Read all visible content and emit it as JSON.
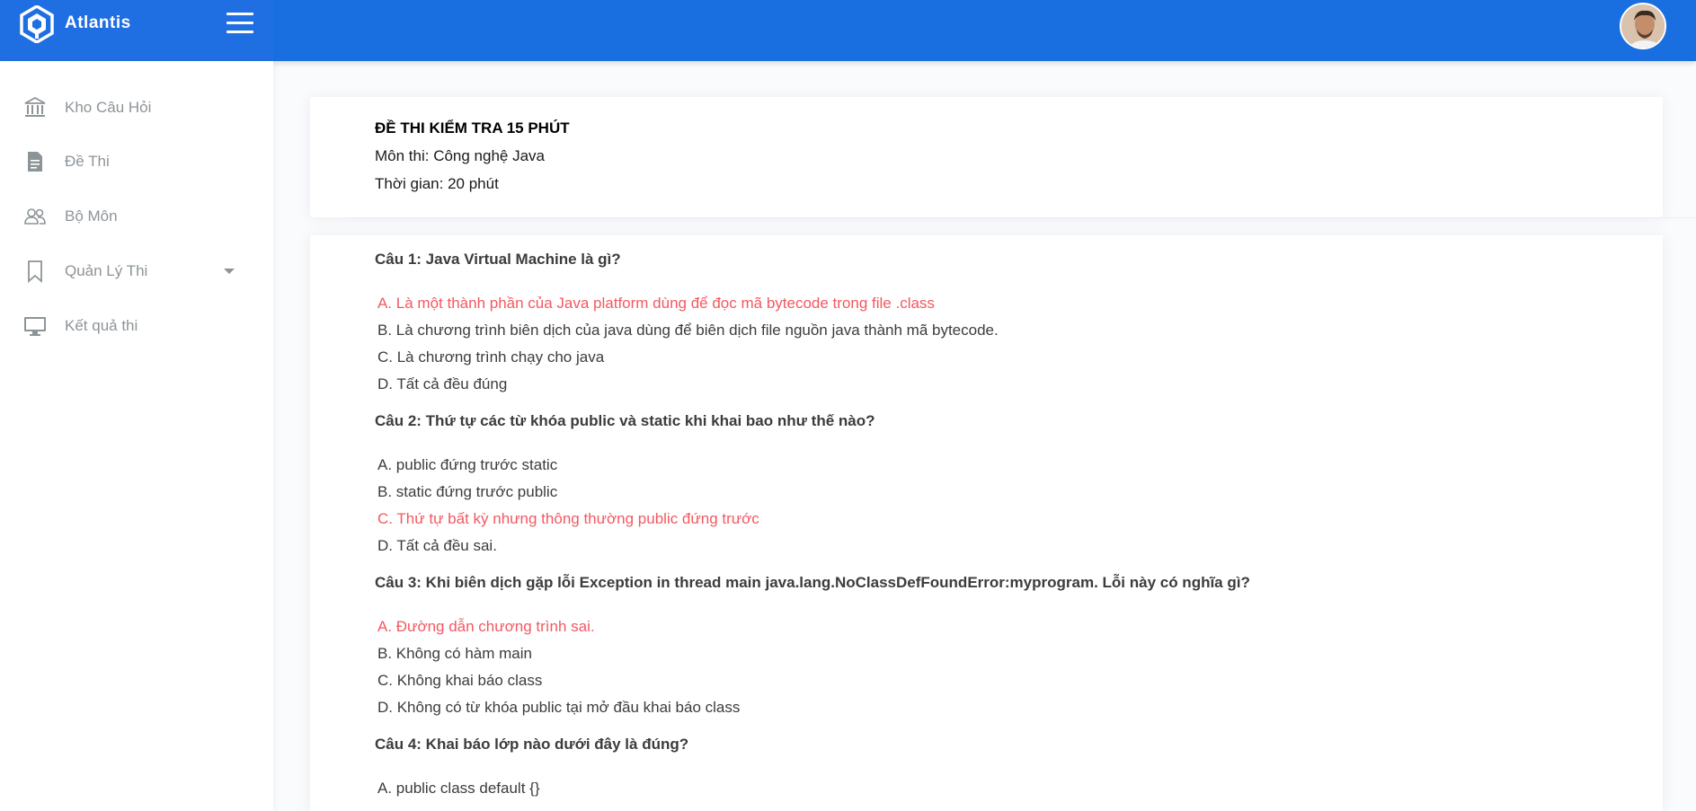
{
  "brand": {
    "name": "Atlantis"
  },
  "topbar": {
    "menu_icon": "hamburger-icon",
    "avatar": "user-avatar"
  },
  "sidebar": {
    "items": [
      {
        "label": "Kho Câu Hỏi",
        "icon": "bank-icon"
      },
      {
        "label": "Đề Thi",
        "icon": "document-icon"
      },
      {
        "label": "Bộ Môn",
        "icon": "users-icon"
      },
      {
        "label": "Quản Lý Thi",
        "icon": "bookmark-icon",
        "has_dropdown": true
      },
      {
        "label": "Kết quả thi",
        "icon": "monitor-icon"
      }
    ]
  },
  "exam": {
    "title": "ĐỀ THI KIỂM TRA 15 PHÚT",
    "subject": "Môn thi: Công nghệ Java",
    "duration": "Thời gian: 20 phút"
  },
  "colors": {
    "correct_answer": "#f25961",
    "topbar": "#1a6fe0"
  },
  "questions": [
    {
      "text": "Câu 1:  Java Virtual Machine là gì?",
      "answers": [
        {
          "text": "A. Là một thành phần của Java platform dùng để đọc mã bytecode trong file .class",
          "correct": true
        },
        {
          "text": "B. Là chương trình biên dịch của java dùng để biên dịch file nguồn java thành mã bytecode.",
          "correct": false
        },
        {
          "text": "C. Là chương trình chạy cho java",
          "correct": false
        },
        {
          "text": "D. Tất cả đều đúng",
          "correct": false
        }
      ]
    },
    {
      "text": "Câu 2: Thứ tự các từ khóa public và static khi khai bao như thế nào?",
      "answers": [
        {
          "text": "A. public đứng trước static",
          "correct": false
        },
        {
          "text": "B. static đứng trước public",
          "correct": false
        },
        {
          "text": "C. Thứ tự bất kỳ nhưng thông thường public đứng trước",
          "correct": true
        },
        {
          "text": "D. Tất cả đều sai.",
          "correct": false
        }
      ]
    },
    {
      "text": "Câu 3: Khi biên dịch gặp lỗi Exception in thread main java.lang.NoClassDefFoundError:myprogram. Lỗi này có nghĩa gì?",
      "answers": [
        {
          "text": "A. Đường dẫn chương trình sai.",
          "correct": true
        },
        {
          "text": "B. Không có hàm main",
          "correct": false
        },
        {
          "text": "C. Không khai báo class",
          "correct": false
        },
        {
          "text": "D. Không có từ khóa public tại mở đầu khai báo class",
          "correct": false
        }
      ]
    },
    {
      "text": "Câu 4: Khai báo lớp nào dưới đây là đúng?",
      "answers": [
        {
          "text": "A. public class default {}",
          "correct": false
        }
      ]
    }
  ]
}
